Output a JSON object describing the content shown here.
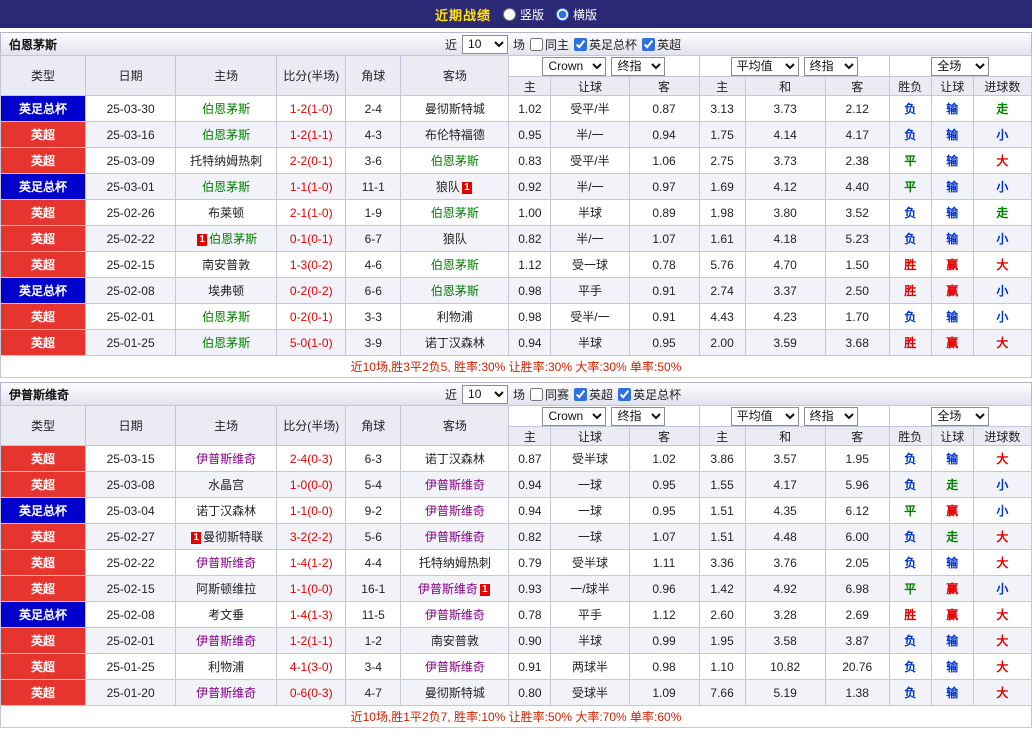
{
  "topbar": {
    "title": "近期战绩",
    "radios": [
      {
        "label": "竖版",
        "checked": false
      },
      {
        "label": "横版",
        "checked": true
      }
    ]
  },
  "labels": {
    "near": "近",
    "matches": "场"
  },
  "selects": {
    "odds_source": "Crown",
    "odds_time": "终指",
    "euro_source": "平均值",
    "euro_time": "终指",
    "scope": "全场"
  },
  "headers": {
    "main": [
      "类型",
      "日期",
      "主场",
      "比分(半场)",
      "角球",
      "客场"
    ],
    "odds_sub": [
      "主",
      "让球",
      "客"
    ],
    "euro_sub": [
      "主",
      "和",
      "客"
    ],
    "result_sub": [
      "胜负",
      "让球",
      "进球数"
    ]
  },
  "leagues": {
    "英超": "#e6342e",
    "英足总杯": "#0000cc"
  },
  "result_colors": {
    "胜": "#e60000",
    "赢": "#e60000",
    "大": "#e60000",
    "平": "#008000",
    "走": "#008000",
    "负": "#0033cc",
    "输": "#0033cc",
    "小": "#0033cc"
  },
  "red_card_label": "1",
  "sections": [
    {
      "team": "伯恩茅斯",
      "team_color": "#008000",
      "count": "10",
      "filters": [
        {
          "label": "同主",
          "checked": false
        },
        {
          "label": "英足总杯",
          "checked": true
        },
        {
          "label": "英超",
          "checked": true
        }
      ],
      "rows": [
        {
          "league": "英足总杯",
          "date": "25-03-30",
          "home": "伯恩茅斯",
          "score": "1-2(1-0)",
          "corner": "2-4",
          "away": "曼彻斯特城",
          "odds": [
            "1.02",
            "受平/半",
            "0.87",
            "3.13",
            "3.73",
            "2.12"
          ],
          "result": "负",
          "handicap": "输",
          "goals": "走"
        },
        {
          "league": "英超",
          "date": "25-03-16",
          "home": "伯恩茅斯",
          "score": "1-2(1-1)",
          "corner": "4-3",
          "away": "布伦特福德",
          "odds": [
            "0.95",
            "半/一",
            "0.94",
            "1.75",
            "4.14",
            "4.17"
          ],
          "result": "负",
          "handicap": "输",
          "goals": "小"
        },
        {
          "league": "英超",
          "date": "25-03-09",
          "home": "托特纳姆热刺",
          "score": "2-2(0-1)",
          "corner": "3-6",
          "away": "伯恩茅斯",
          "odds": [
            "0.83",
            "受平/半",
            "1.06",
            "2.75",
            "3.73",
            "2.38"
          ],
          "result": "平",
          "handicap": "输",
          "goals": "大"
        },
        {
          "league": "英足总杯",
          "date": "25-03-01",
          "home": "伯恩茅斯",
          "score": "1-1(1-0)",
          "corner": "11-1",
          "away": "狼队",
          "away_card": true,
          "odds": [
            "0.92",
            "半/一",
            "0.97",
            "1.69",
            "4.12",
            "4.40"
          ],
          "result": "平",
          "handicap": "输",
          "goals": "小"
        },
        {
          "league": "英超",
          "date": "25-02-26",
          "home": "布莱顿",
          "score": "2-1(1-0)",
          "corner": "1-9",
          "away": "伯恩茅斯",
          "odds": [
            "1.00",
            "半球",
            "0.89",
            "1.98",
            "3.80",
            "3.52"
          ],
          "result": "负",
          "handicap": "输",
          "goals": "走"
        },
        {
          "league": "英超",
          "date": "25-02-22",
          "home": "伯恩茅斯",
          "home_card": true,
          "score": "0-1(0-1)",
          "corner": "6-7",
          "away": "狼队",
          "odds": [
            "0.82",
            "半/一",
            "1.07",
            "1.61",
            "4.18",
            "5.23"
          ],
          "result": "负",
          "handicap": "输",
          "goals": "小"
        },
        {
          "league": "英超",
          "date": "25-02-15",
          "home": "南安普敦",
          "score": "1-3(0-2)",
          "corner": "4-6",
          "away": "伯恩茅斯",
          "odds": [
            "1.12",
            "受一球",
            "0.78",
            "5.76",
            "4.70",
            "1.50"
          ],
          "result": "胜",
          "handicap": "赢",
          "goals": "大"
        },
        {
          "league": "英足总杯",
          "date": "25-02-08",
          "home": "埃弗顿",
          "score": "0-2(0-2)",
          "corner": "6-6",
          "away": "伯恩茅斯",
          "odds": [
            "0.98",
            "平手",
            "0.91",
            "2.74",
            "3.37",
            "2.50"
          ],
          "result": "胜",
          "handicap": "赢",
          "goals": "小"
        },
        {
          "league": "英超",
          "date": "25-02-01",
          "home": "伯恩茅斯",
          "score": "0-2(0-1)",
          "corner": "3-3",
          "away": "利物浦",
          "odds": [
            "0.98",
            "受半/一",
            "0.91",
            "4.43",
            "4.23",
            "1.70"
          ],
          "result": "负",
          "handicap": "输",
          "goals": "小"
        },
        {
          "league": "英超",
          "date": "25-01-25",
          "home": "伯恩茅斯",
          "score": "5-0(1-0)",
          "corner": "3-9",
          "away": "诺丁汉森林",
          "odds": [
            "0.94",
            "半球",
            "0.95",
            "2.00",
            "3.59",
            "3.68"
          ],
          "result": "胜",
          "handicap": "赢",
          "goals": "大"
        }
      ],
      "summary": "近10场,胜3平2负5, 胜率:30% 让胜率:30% 大率:30% 单率:50%"
    },
    {
      "team": "伊普斯维奇",
      "team_color": "#800080",
      "count": "10",
      "filters": [
        {
          "label": "同赛",
          "checked": false
        },
        {
          "label": "英超",
          "checked": true
        },
        {
          "label": "英足总杯",
          "checked": true
        }
      ],
      "rows": [
        {
          "league": "英超",
          "date": "25-03-15",
          "home": "伊普斯维奇",
          "score": "2-4(0-3)",
          "corner": "6-3",
          "away": "诺丁汉森林",
          "odds": [
            "0.87",
            "受半球",
            "1.02",
            "3.86",
            "3.57",
            "1.95"
          ],
          "result": "负",
          "handicap": "输",
          "goals": "大"
        },
        {
          "league": "英超",
          "date": "25-03-08",
          "home": "水晶宫",
          "score": "1-0(0-0)",
          "corner": "5-4",
          "away": "伊普斯维奇",
          "odds": [
            "0.94",
            "一球",
            "0.95",
            "1.55",
            "4.17",
            "5.96"
          ],
          "result": "负",
          "handicap": "走",
          "goals": "小"
        },
        {
          "league": "英足总杯",
          "date": "25-03-04",
          "home": "诺丁汉森林",
          "score": "1-1(0-0)",
          "corner": "9-2",
          "away": "伊普斯维奇",
          "odds": [
            "0.94",
            "一球",
            "0.95",
            "1.51",
            "4.35",
            "6.12"
          ],
          "result": "平",
          "handicap": "赢",
          "goals": "小"
        },
        {
          "league": "英超",
          "date": "25-02-27",
          "home": "曼彻斯特联",
          "home_card": true,
          "score": "3-2(2-2)",
          "corner": "5-6",
          "away": "伊普斯维奇",
          "odds": [
            "0.82",
            "一球",
            "1.07",
            "1.51",
            "4.48",
            "6.00"
          ],
          "result": "负",
          "handicap": "走",
          "goals": "大"
        },
        {
          "league": "英超",
          "date": "25-02-22",
          "home": "伊普斯维奇",
          "score": "1-4(1-2)",
          "corner": "4-4",
          "away": "托特纳姆热刺",
          "odds": [
            "0.79",
            "受半球",
            "1.11",
            "3.36",
            "3.76",
            "2.05"
          ],
          "result": "负",
          "handicap": "输",
          "goals": "大"
        },
        {
          "league": "英超",
          "date": "25-02-15",
          "home": "阿斯顿维拉",
          "score": "1-1(0-0)",
          "corner": "16-1",
          "away": "伊普斯维奇",
          "away_card": true,
          "odds": [
            "0.93",
            "一/球半",
            "0.96",
            "1.42",
            "4.92",
            "6.98"
          ],
          "result": "平",
          "handicap": "赢",
          "goals": "小"
        },
        {
          "league": "英足总杯",
          "date": "25-02-08",
          "home": "考文垂",
          "score": "1-4(1-3)",
          "corner": "11-5",
          "away": "伊普斯维奇",
          "odds": [
            "0.78",
            "平手",
            "1.12",
            "2.60",
            "3.28",
            "2.69"
          ],
          "result": "胜",
          "handicap": "赢",
          "goals": "大"
        },
        {
          "league": "英超",
          "date": "25-02-01",
          "home": "伊普斯维奇",
          "score": "1-2(1-1)",
          "corner": "1-2",
          "away": "南安普敦",
          "odds": [
            "0.90",
            "半球",
            "0.99",
            "1.95",
            "3.58",
            "3.87"
          ],
          "result": "负",
          "handicap": "输",
          "goals": "大"
        },
        {
          "league": "英超",
          "date": "25-01-25",
          "home": "利物浦",
          "score": "4-1(3-0)",
          "corner": "3-4",
          "away": "伊普斯维奇",
          "odds": [
            "0.91",
            "两球半",
            "0.98",
            "1.10",
            "10.82",
            "20.76"
          ],
          "result": "负",
          "handicap": "输",
          "goals": "大"
        },
        {
          "league": "英超",
          "date": "25-01-20",
          "home": "伊普斯维奇",
          "score": "0-6(0-3)",
          "corner": "4-7",
          "away": "曼彻斯特城",
          "odds": [
            "0.80",
            "受球半",
            "1.09",
            "7.66",
            "5.19",
            "1.38"
          ],
          "result": "负",
          "handicap": "输",
          "goals": "大"
        }
      ],
      "summary": "近10场,胜1平2负7, 胜率:10% 让胜率:50% 大率:70% 单率:60%"
    }
  ]
}
